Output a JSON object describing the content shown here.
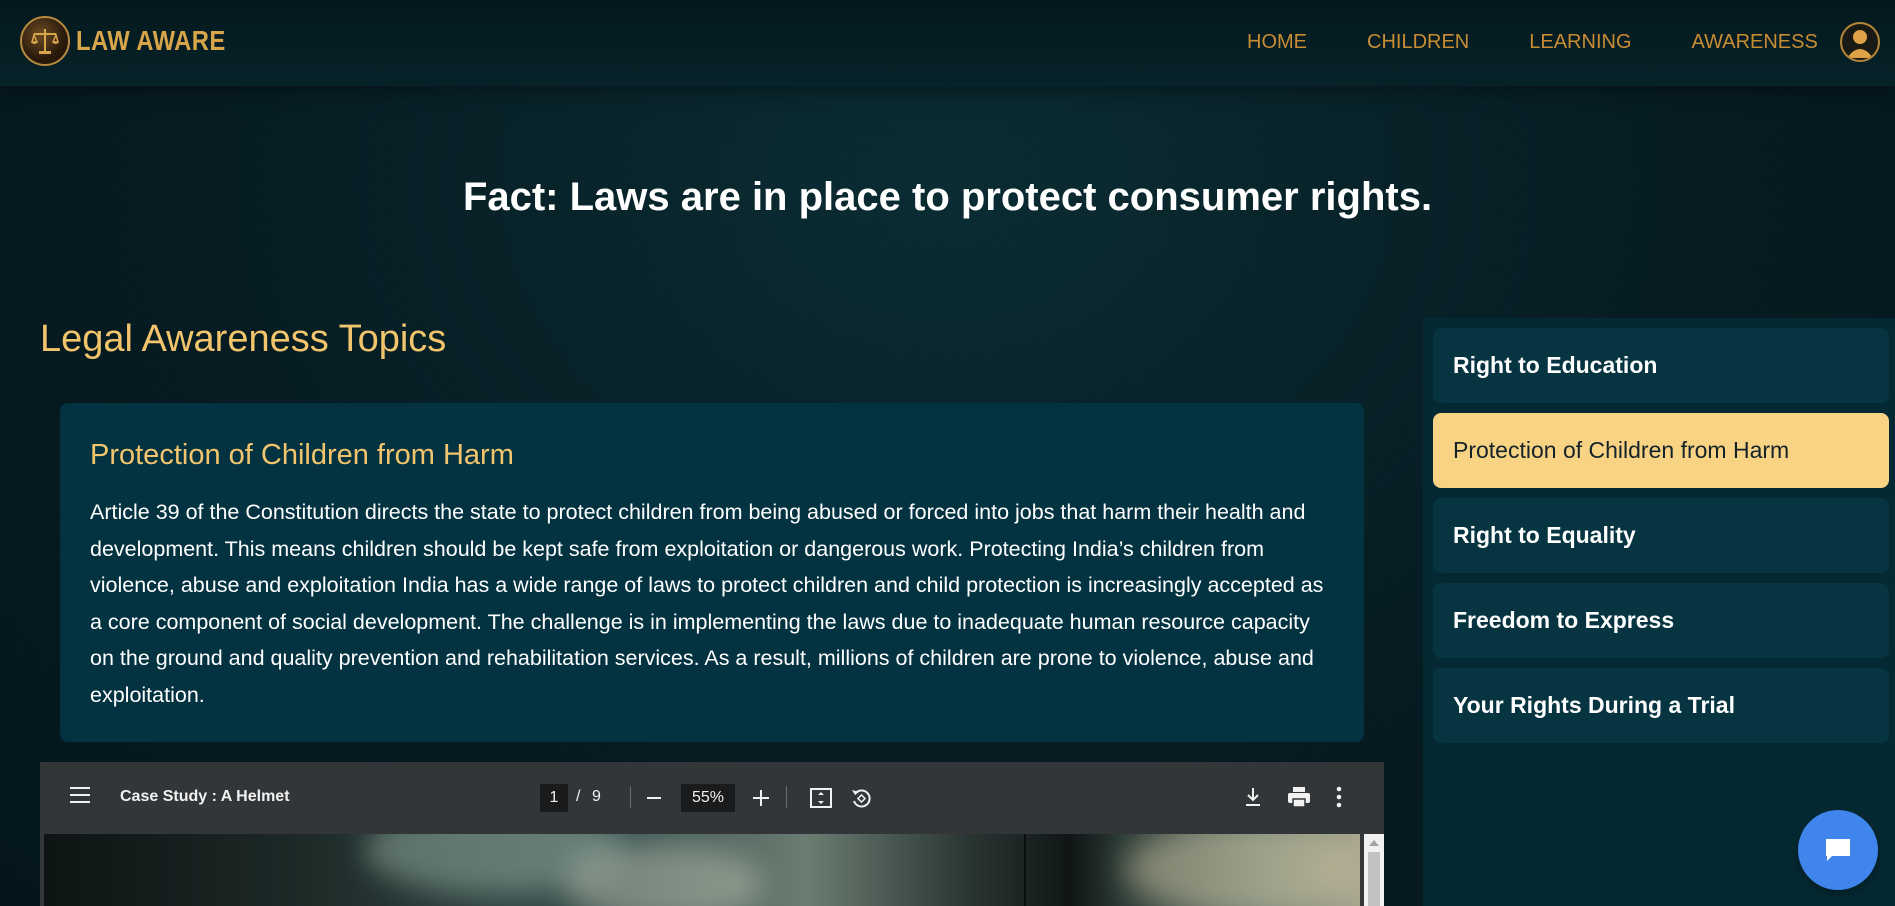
{
  "brand": {
    "name": "LAW AWARE",
    "icon": "scales-of-justice-logo-icon"
  },
  "nav": {
    "links": [
      "HOME",
      "CHILDREN",
      "LEARNING",
      "AWARENESS"
    ],
    "avatar_icon": "user-avatar-icon"
  },
  "fact": {
    "text": "Fact: Laws are in place to protect consumer rights."
  },
  "main": {
    "section_title": "Legal Awareness Topics",
    "card": {
      "title": "Protection of Children from Harm",
      "body": "Article 39 of the Constitution directs the state to protect children from being abused or forced into jobs that harm their health and development. This means children should be kept safe from exploitation or dangerous work. Protecting India’s children from violence, abuse and exploitation India has a wide range of laws to protect children and child protection is increasingly accepted as a core component of social development. The challenge is in implementing the laws due to inadequate human resource capacity on the ground and quality prevention and rehabilitation services. As a result, millions of children are prone to violence, abuse and exploitation."
    }
  },
  "pdf_viewer": {
    "title": "Case Study : A Helmet",
    "current_page": "1",
    "page_separator": "/",
    "total_pages": "9",
    "zoom": "55%",
    "icons": [
      "menu-icon",
      "zoom-out-icon",
      "zoom-in-icon",
      "fit-page-icon",
      "rotate-icon",
      "download-icon",
      "print-icon",
      "more-options-icon"
    ]
  },
  "sidebar": {
    "items": [
      {
        "label": "Right to Education",
        "active": false
      },
      {
        "label": "Protection of Children from Harm",
        "active": true
      },
      {
        "label": "Right to Equality",
        "active": false
      },
      {
        "label": "Freedom to Express",
        "active": false
      },
      {
        "label": "Your Rights During a Trial",
        "active": false
      }
    ]
  },
  "chat": {
    "icon": "chat-bubble-icon"
  },
  "colors": {
    "accent_gold": "#f2c56d",
    "nav_gold": "#c88d34",
    "active_item": "#f7d383",
    "card_bg": "#033341",
    "chat_blue": "#3f85ec"
  }
}
